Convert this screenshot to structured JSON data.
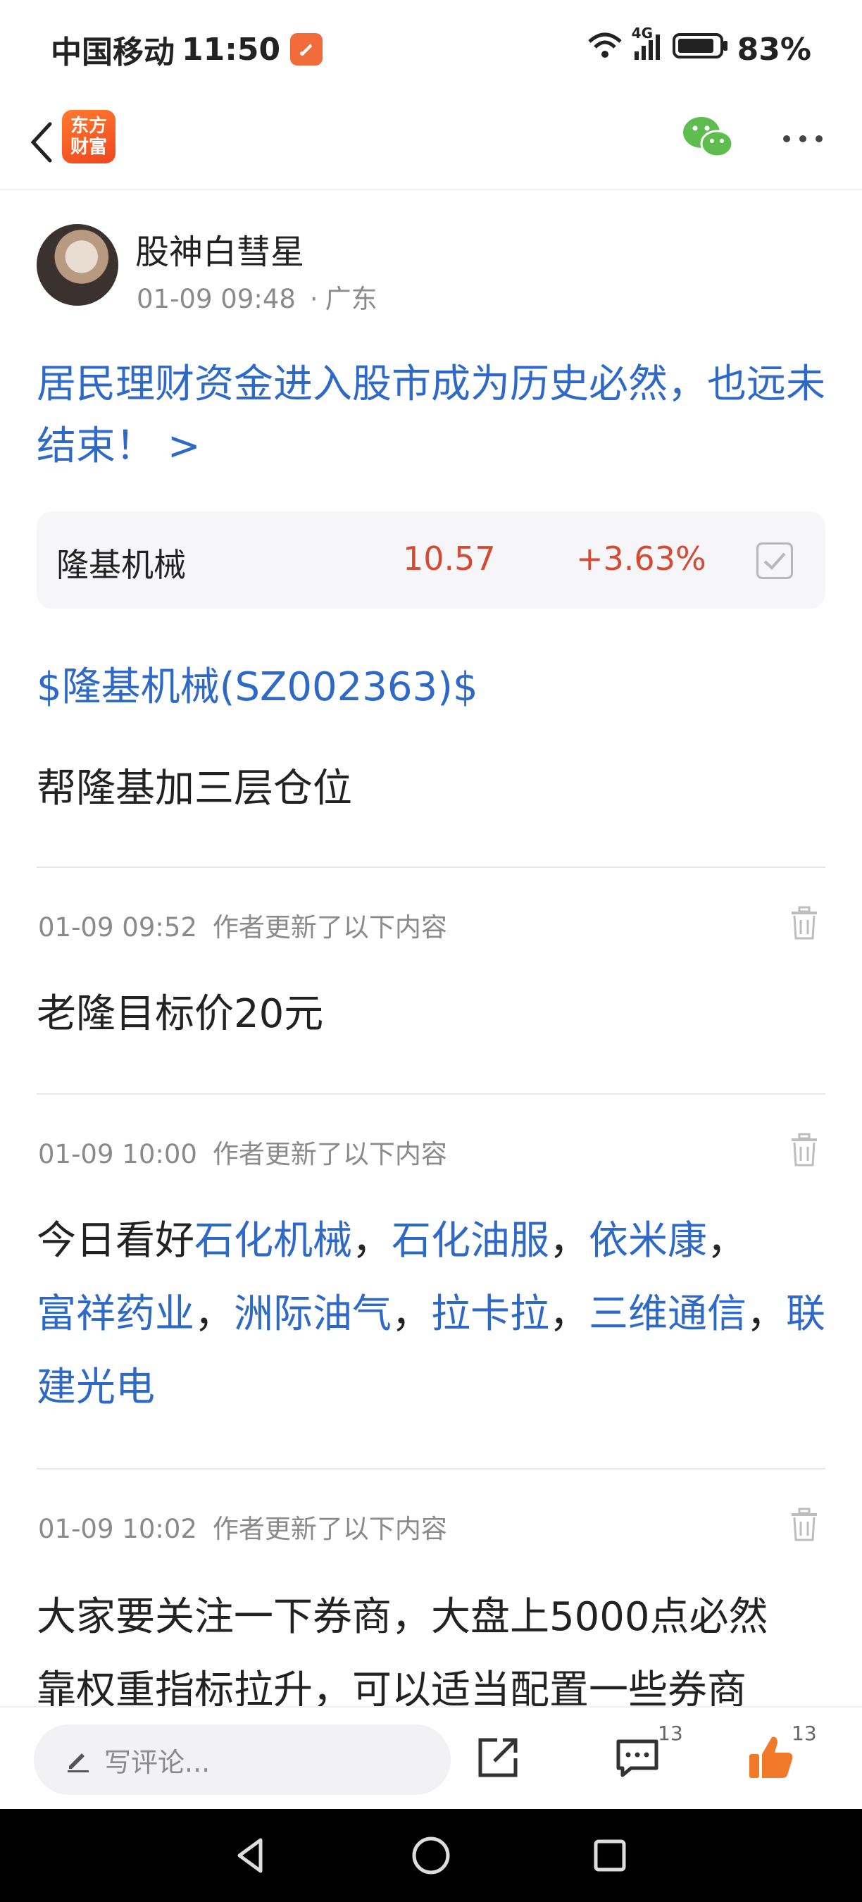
{
  "status_bar": {
    "carrier": "中国移动",
    "time": "11:50",
    "network": "4G",
    "battery": "83%"
  },
  "nav": {
    "logo_line1": "东方",
    "logo_line2": "财富"
  },
  "post": {
    "author": "股神白彗星",
    "datetime": "01-09 09:48",
    "location": "广东",
    "title": "居民理财资金进入股市成为历史必然，也远未结束！ >",
    "stock": {
      "name": "隆基机械",
      "price": "10.57",
      "change": "+3.63%"
    },
    "stock_tag": "$隆基机械(SZ002363)$",
    "body": "帮隆基加三层仓位"
  },
  "updates": [
    {
      "time": "01-09 09:52",
      "label": "作者更新了以下内容",
      "text": "老隆目标价20元"
    },
    {
      "time": "01-09 10:00",
      "label": "作者更新了以下内容",
      "prefix": "今日看好",
      "stocks": [
        "石化机械",
        "石化油服",
        "依米康",
        "富祥药业",
        "洲际油气",
        "拉卡拉",
        "三维通信",
        "联建光电"
      ],
      "sep": "，"
    },
    {
      "time": "01-09 10:02",
      "label": "作者更新了以下内容",
      "line1": "大家要关注一下券商，大盘上5000点必然",
      "line2": "靠权重指标拉升，可以适当配置一些券商"
    }
  ],
  "bottom_bar": {
    "comment_placeholder": "写评论...",
    "comment_count": "13",
    "like_count": "13"
  },
  "colors": {
    "link_blue": "#2e69c7",
    "price_red": "#d44a35",
    "brand_orange": "#f26b3a"
  }
}
